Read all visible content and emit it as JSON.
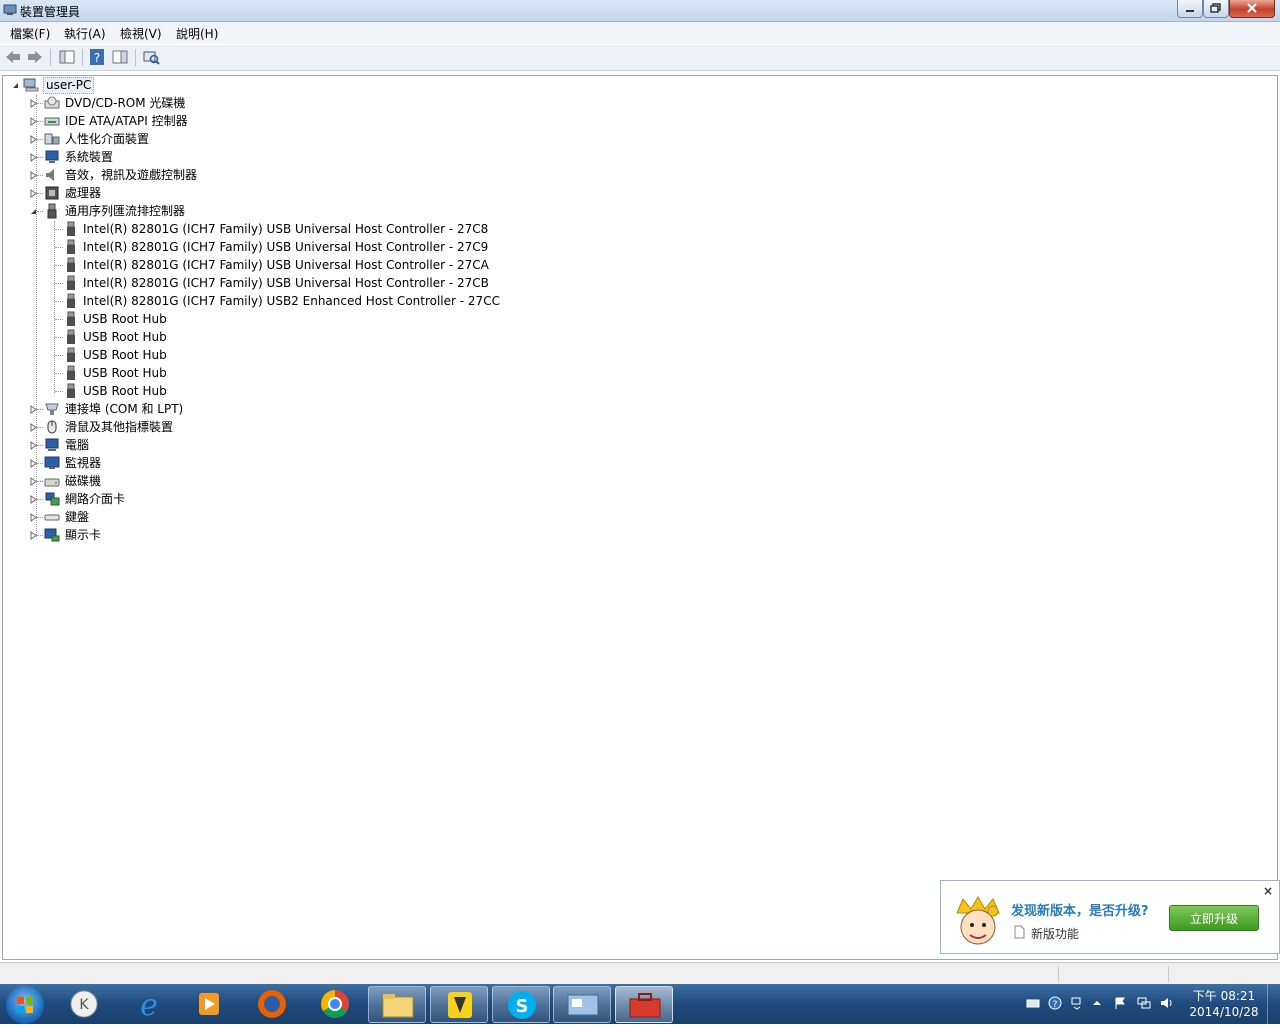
{
  "window": {
    "title": "裝置管理員"
  },
  "menu": {
    "items": [
      "檔案(F)",
      "執行(A)",
      "檢視(V)",
      "說明(H)"
    ]
  },
  "tree": {
    "root": "user-PC",
    "categories_top": [
      "DVD/CD-ROM 光碟機",
      "IDE ATA/ATAPI 控制器",
      "人性化介面裝置",
      "系統裝置",
      "音效，視訊及遊戲控制器",
      "處理器"
    ],
    "expanded_category": "通用序列匯流排控制器",
    "usb_children": [
      "Intel(R) 82801G (ICH7 Family) USB Universal Host Controller - 27C8",
      "Intel(R) 82801G (ICH7 Family) USB Universal Host Controller - 27C9",
      "Intel(R) 82801G (ICH7 Family) USB Universal Host Controller - 27CA",
      "Intel(R) 82801G (ICH7 Family) USB Universal Host Controller - 27CB",
      "Intel(R) 82801G (ICH7 Family) USB2 Enhanced Host Controller - 27CC",
      "USB Root Hub",
      "USB Root Hub",
      "USB Root Hub",
      "USB Root Hub",
      "USB Root Hub"
    ],
    "categories_bottom": [
      "連接埠 (COM 和 LPT)",
      "滑鼠及其他指標裝置",
      "電腦",
      "監視器",
      "磁碟機",
      "網路介面卡",
      "鍵盤",
      "顯示卡"
    ]
  },
  "popup": {
    "title": "发现新版本，是否升级?",
    "feature_link": "新版功能",
    "upgrade_button": "立即升级",
    "close": "×"
  },
  "taskbar": {
    "time": "下午 08:21",
    "date": "2014/10/28"
  },
  "colors": {
    "taskbar": "#1e4a7c",
    "popup_title": "#2a7bb9",
    "upgrade_button": "#4caa2a"
  }
}
